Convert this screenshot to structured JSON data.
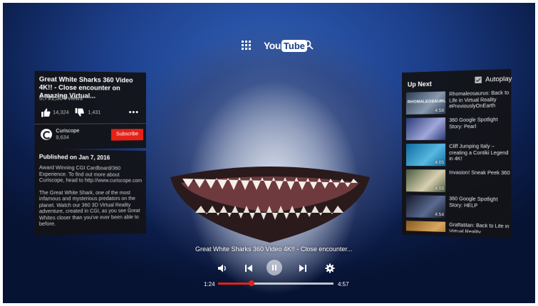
{
  "top_bar": {
    "logo_you": "You",
    "logo_tube": "Tube"
  },
  "video": {
    "title": "Great White Sharks 360 Video 4K!! - Close encounter on Amazing Virtual...",
    "views": "5,791,304 views",
    "likes": "14,324",
    "dislikes": "1,431",
    "channel_name": "Curiscope",
    "channel_subscribers": "9,634",
    "subscribe_label": "Subscribe"
  },
  "description": {
    "published": "Published on Jan 7, 2016",
    "paragraph_1": "Award Winning CGI Cardboard/360 Experience. To find out more about Curiscope, head to http://www.curiscope.com",
    "paragraph_2": "The Great White Shark, one of the most infamous and mysterious predators on the planet. Watch our 360 3D Virtual Reality adventure, created in CGI, as you see Great Whites closer than you've ever been able to before."
  },
  "up_next": {
    "label": "Up Next",
    "autoplay_label": "Autoplay",
    "autoplay_checked": true,
    "items": [
      {
        "title": "Rhomaleosaurus: Back to Life in Virtual Reality #PreviouslyOnEarth",
        "duration": "4:58",
        "thumb_text": "RHOMALEOSAURUS",
        "colors": [
          "#2c3e55",
          "#8a9bb0"
        ]
      },
      {
        "title": "360 Google Spotlight Story: Pearl",
        "duration": "",
        "thumb_text": "",
        "colors": [
          "#2a3a7a",
          "#a0a8d8"
        ]
      },
      {
        "title": "Cliff Jumping Italy – creating a Contiki Legend in 4K!",
        "duration": "4:05",
        "thumb_text": "",
        "colors": [
          "#0e6aa0",
          "#58b8e0"
        ]
      },
      {
        "title": "Invasion! Sneak Peek 360",
        "duration": "4:05",
        "thumb_text": "",
        "colors": [
          "#4a5a40",
          "#d8d0b0"
        ]
      },
      {
        "title": "360 Google Spotlight Story: HELP",
        "duration": "4:54",
        "thumb_text": "",
        "colors": [
          "#141828",
          "#5a6a90"
        ]
      },
      {
        "title": "Graffatitan: Back to Life in Virtual Reality",
        "duration": "",
        "thumb_text": "",
        "colors": [
          "#8a5a20",
          "#d8a860"
        ]
      }
    ]
  },
  "player": {
    "now_playing_title": "Great White Sharks 360 Video 4K!! - Close encounter...",
    "current_time": "1:24",
    "duration": "4:57",
    "progress_fraction": 0.29
  },
  "colors": {
    "accent": "#e62117",
    "panel_bg": "#121216"
  },
  "icons": {
    "apps": "apps-grid-icon",
    "search": "search-icon",
    "like": "thumbs-up-icon",
    "dislike": "thumbs-down-icon",
    "more": "more-horizontal-icon",
    "volume": "volume-icon",
    "previous": "skip-previous-icon",
    "pause": "pause-icon",
    "next": "skip-next-icon",
    "settings": "gear-icon"
  }
}
